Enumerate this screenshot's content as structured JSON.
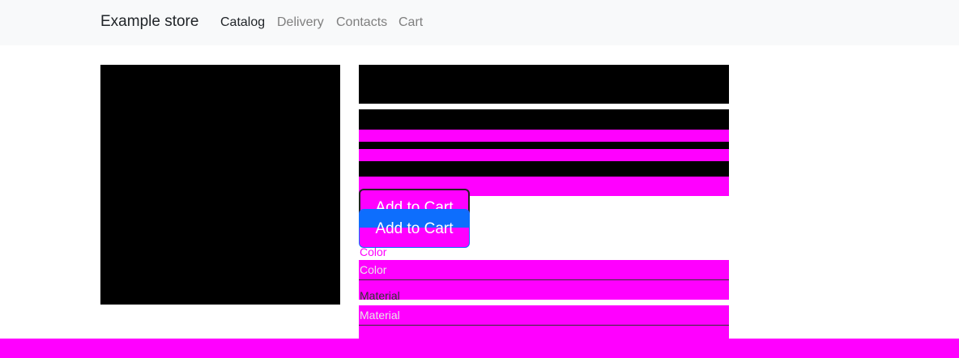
{
  "nav": {
    "brand": "Example store",
    "links": [
      {
        "label": "Catalog",
        "active": true
      },
      {
        "label": "Delivery",
        "active": false
      },
      {
        "label": "Contacts",
        "active": false
      },
      {
        "label": "Cart",
        "active": false
      }
    ]
  },
  "product": {
    "add_to_cart_label": "Add to Cart",
    "add_to_cart_label_duplicate": "Add to Cart",
    "color_label": "Color",
    "color_placeholder": "Color",
    "material_label": "Material",
    "material_placeholder": "Material"
  },
  "colors": {
    "placeholder_fill": "#ff00ff",
    "redacted_fill": "#000000",
    "primary": "#0d6efd",
    "navbar_bg": "#f8f9fa"
  }
}
